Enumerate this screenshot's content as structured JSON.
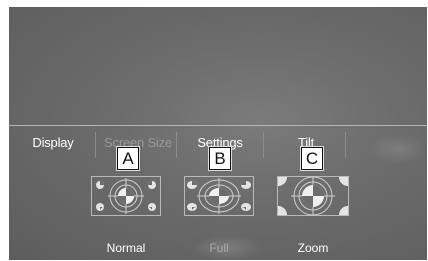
{
  "tabs": [
    {
      "label": "Display"
    },
    {
      "label": "Screen Size"
    },
    {
      "label": "Settings"
    },
    {
      "label": "Tilt"
    }
  ],
  "markers": [
    "A",
    "B",
    "C"
  ],
  "size_options": [
    {
      "label": "Normal",
      "icon": "screen-size-normal-icon"
    },
    {
      "label": "Full",
      "icon": "screen-size-full-icon"
    },
    {
      "label": "Zoom",
      "icon": "screen-size-zoom-icon"
    }
  ],
  "colors": {
    "background": "#6c6c6c",
    "text": "#ffffff",
    "dim_text": "#9a9a9a",
    "divider": "#b6b6b6"
  }
}
